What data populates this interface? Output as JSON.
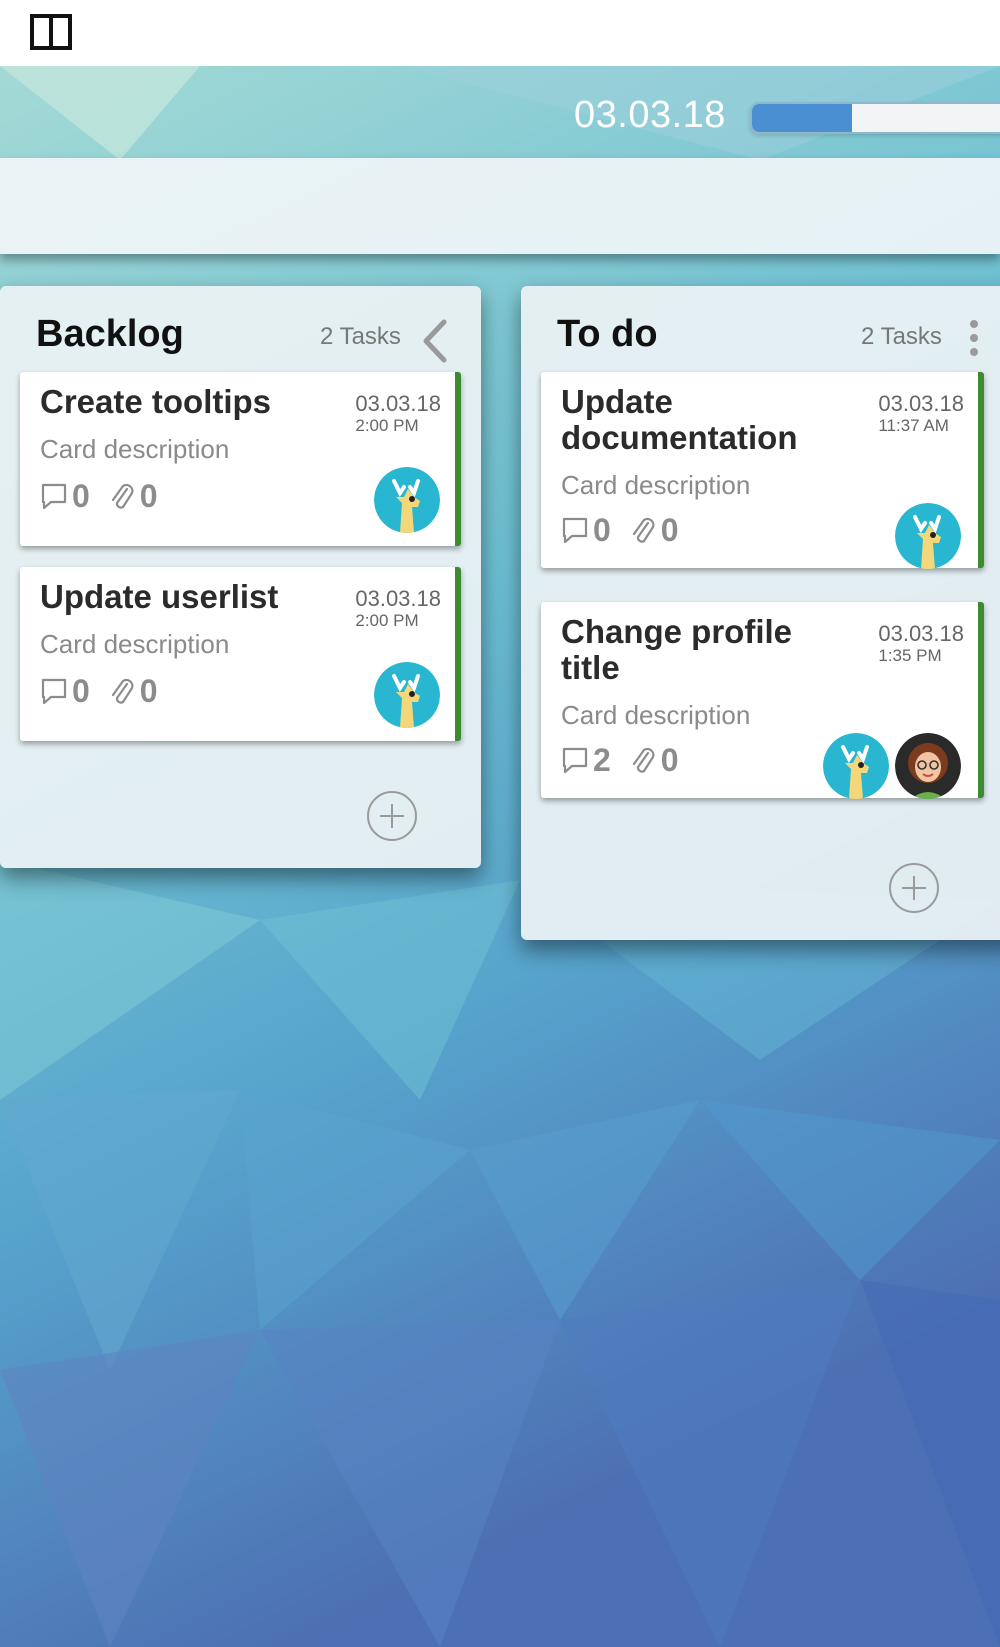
{
  "colors": {
    "accent_progress": "#4a8fd2",
    "card_stripe": "#3a8c2e",
    "avatar_teal": "#29b6d0"
  },
  "header": {
    "panel_toggle_icon": "split-panel-icon",
    "board_date": "03.03.18",
    "progress_percent": 37
  },
  "columns": [
    {
      "title": "Backlog",
      "task_count": "2 Tasks",
      "control_icon": "chevron-left-icon",
      "cards": [
        {
          "title": "Create tooltips",
          "date": "03.03.18",
          "time": "2:00 PM",
          "description": "Card description",
          "comments": "0",
          "attachments": "0",
          "avatars": [
            "moose-avatar"
          ]
        },
        {
          "title": "Update userlist",
          "date": "03.03.18",
          "time": "2:00 PM",
          "description": "Card description",
          "comments": "0",
          "attachments": "0",
          "avatars": [
            "moose-avatar"
          ]
        }
      ],
      "add_icon": "plus-circle-icon"
    },
    {
      "title": "To do",
      "task_count": "2 Tasks",
      "control_icon": "kebab-menu-icon",
      "cards": [
        {
          "title": "Update documentation",
          "date": "03.03.18",
          "time": "11:37 AM",
          "description": "Card description",
          "comments": "0",
          "attachments": "0",
          "avatars": [
            "moose-avatar"
          ]
        },
        {
          "title": "Change profile title",
          "date": "03.03.18",
          "time": "1:35 PM",
          "description": "Card description",
          "comments": "2",
          "attachments": "0",
          "avatars": [
            "moose-avatar",
            "woman-avatar"
          ]
        }
      ],
      "add_icon": "plus-circle-icon"
    }
  ]
}
